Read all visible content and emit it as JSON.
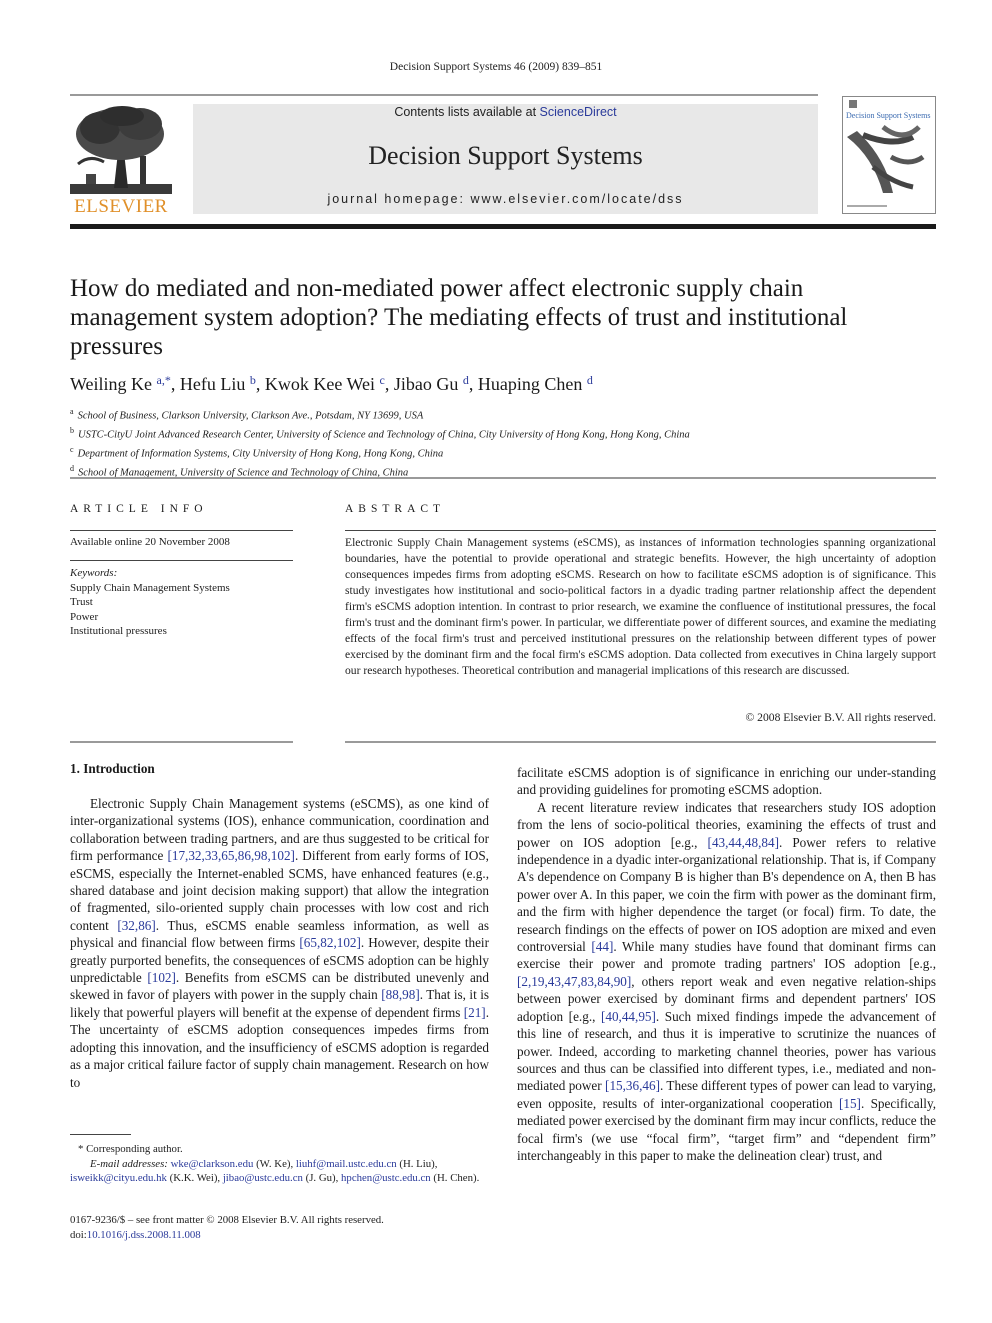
{
  "header": {
    "running_head": "Decision Support Systems 46 (2009) 839–851",
    "contents_prefix": "Contents lists available at ",
    "contents_link": "ScienceDirect",
    "journal_name": "Decision Support Systems",
    "homepage": "journal homepage: www.elsevier.com/locate/dss",
    "publisher": "ELSEVIER",
    "cover_title": "Decision Support Systems"
  },
  "colors": {
    "link": "#2a3a9a",
    "publisher_orange": "#e0902a",
    "band": "#e8e8e8"
  },
  "article": {
    "title": "How do mediated and non-mediated power affect electronic supply chain management system adoption? The mediating effects of trust and institutional pressures",
    "authors": [
      {
        "name": "Weiling Ke",
        "sup": "a,*"
      },
      {
        "name": "Hefu Liu",
        "sup": "b"
      },
      {
        "name": "Kwok Kee Wei",
        "sup": "c"
      },
      {
        "name": "Jibao Gu",
        "sup": "d"
      },
      {
        "name": "Huaping Chen",
        "sup": "d"
      }
    ],
    "affiliations": [
      {
        "sup": "a",
        "text": "School of Business, Clarkson University, Clarkson Ave., Potsdam, NY 13699, USA"
      },
      {
        "sup": "b",
        "text": "USTC-CityU Joint Advanced Research Center, University of Science and Technology of China, City University of Hong Kong, Hong Kong, China"
      },
      {
        "sup": "c",
        "text": "Department of Information Systems, City University of Hong Kong, Hong Kong, China"
      },
      {
        "sup": "d",
        "text": "School of Management, University of Science and Technology of China, China"
      }
    ]
  },
  "article_info": {
    "heading": "ARTICLE INFO",
    "available_online": "Available online 20 November 2008",
    "keywords_label": "Keywords:",
    "keywords": [
      "Supply Chain Management Systems",
      "Trust",
      "Power",
      "Institutional pressures"
    ]
  },
  "abstract": {
    "heading": "ABSTRACT",
    "text": "Electronic Supply Chain Management systems (eSCMS), as instances of information technologies spanning organizational boundaries, have the potential to provide operational and strategic benefits. However, the high uncertainty of adoption consequences impedes firms from adopting eSCMS. Research on how to facilitate eSCMS adoption is of significance. This study investigates how institutional and socio-political factors in a dyadic trading partner relationship affect the dependent firm's eSCMS adoption intention. In contrast to prior research, we examine the confluence of institutional pressures, the focal firm's trust and the dominant firm's power. In particular, we differentiate power of different sources, and examine the mediating effects of the focal firm's trust and perceived institutional pressures on the relationship between different types of power exercised by the dominant firm and the focal firm's eSCMS adoption. Data collected from executives in China largely support our research hypotheses. Theoretical contribution and managerial implications of this research are discussed.",
    "copyright": "© 2008 Elsevier B.V. All rights reserved."
  },
  "body": {
    "section_heading": "1. Introduction",
    "left_col": [
      {
        "t": "Electronic Supply Chain Management systems (eSCMS), as one kind of inter-organizational systems (IOS), enhance communication, coordination and collaboration between trading partners, and are thus suggested to be critical for firm performance "
      },
      {
        "t": "[17,32,33,65,86,98,102]",
        "link": true
      },
      {
        "t": ". Different from early forms of IOS, eSCMS, especially the Internet-enabled SCMS, have enhanced features (e.g., shared database and joint decision making support) that allow the integration of fragmented, silo-oriented supply chain processes with low cost and rich content "
      },
      {
        "t": "[32,86]",
        "link": true
      },
      {
        "t": ". Thus, eSCMS enable seamless information, as well as physical and financial flow between firms "
      },
      {
        "t": "[65,82,102]",
        "link": true
      },
      {
        "t": ". However, despite their greatly purported benefits, the consequences of eSCMS adoption can be highly unpredictable "
      },
      {
        "t": "[102]",
        "link": true
      },
      {
        "t": ". Benefits from eSCMS can be distributed unevenly and skewed in favor of players with power in the supply chain "
      },
      {
        "t": "[88,98]",
        "link": true
      },
      {
        "t": ". That is, it is likely that powerful players will benefit at the expense of dependent firms "
      },
      {
        "t": "[21]",
        "link": true
      },
      {
        "t": ". The uncertainty of eSCMS adoption consequences impedes firms from adopting this innovation, and the insufficiency of eSCMS adoption is regarded as a major critical failure factor of supply chain management. Research on how to"
      }
    ],
    "right_col_p1": "facilitate eSCMS adoption is of significance in enriching our under-standing and providing guidelines for promoting eSCMS adoption.",
    "right_col_p2": [
      {
        "t": "A recent literature review indicates that researchers study IOS adoption from the lens of socio-political theories, examining the effects of trust and power on IOS adoption [e.g., "
      },
      {
        "t": "[43,44,48,84]",
        "link": true
      },
      {
        "t": ". Power refers to relative independence in a dyadic inter-organizational relationship. That is, if Company A's dependence on Company B is higher than B's dependence on A, then B has power over A. In this paper, we coin the firm with power as the dominant firm, and the firm with higher dependence the target (or focal) firm. To date, the research findings on the effects of power on IOS adoption are mixed and even controversial "
      },
      {
        "t": "[44]",
        "link": true
      },
      {
        "t": ". While many studies have found that dominant firms can exercise their power and promote trading partners' IOS adoption [e.g., "
      },
      {
        "t": "[2,19,43,47,83,84,90]",
        "link": true
      },
      {
        "t": ", others report weak and even negative relation-ships between power exercised by dominant firms and dependent partners' IOS adoption [e.g., "
      },
      {
        "t": "[40,44,95]",
        "link": true
      },
      {
        "t": ". Such mixed findings impede the advancement of this line of research, and thus it is imperative to scrutinize the nuances of power. Indeed, according to marketing channel theories, power has various sources and thus can be classified into different types, i.e., mediated and non-mediated power "
      },
      {
        "t": "[15,36,46]",
        "link": true
      },
      {
        "t": ". These different types of power can lead to varying, even opposite, results of inter-organizational cooperation "
      },
      {
        "t": "[15]",
        "link": true
      },
      {
        "t": ". Specifically, mediated power exercised by the dominant firm may incur conflicts, reduce the focal firm's (we use “focal firm”, “target firm” and “dependent firm” interchangeably in this paper to make the delineation clear) trust, and"
      }
    ]
  },
  "footnotes": {
    "corresponding": "* Corresponding author.",
    "email_label": "E-mail addresses: ",
    "emails": [
      {
        "addr": "wke@clarkson.edu",
        "who": " (W. Ke), "
      },
      {
        "addr": "liuhf@mail.ustc.edu.cn",
        "who": " (H. Liu), "
      },
      {
        "addr": "isweikk@cityu.edu.hk",
        "who": " (K.K. Wei), "
      },
      {
        "addr": "jibao@ustc.edu.cn",
        "who": " (J. Gu), "
      },
      {
        "addr": "hpchen@ustc.edu.cn",
        "who": " (H. Chen)."
      }
    ],
    "front_matter": "0167-9236/$ – see front matter © 2008 Elsevier B.V. All rights reserved.",
    "doi_label": "doi:",
    "doi": "10.1016/j.dss.2008.11.008"
  }
}
